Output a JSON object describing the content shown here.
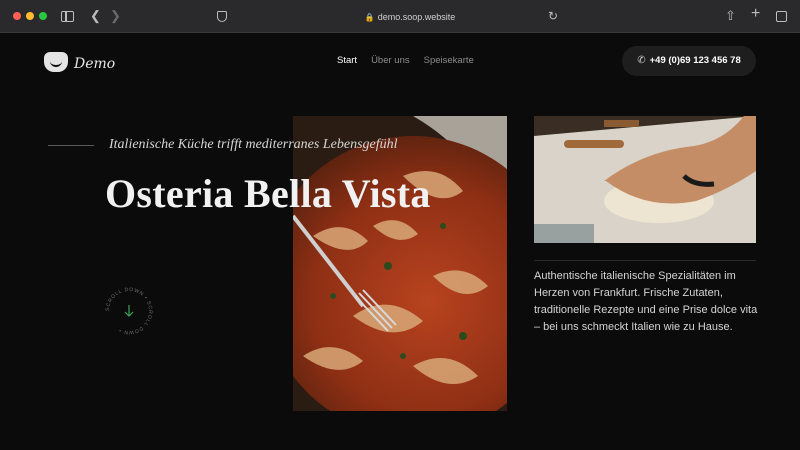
{
  "browser": {
    "url": "demo.soop.website"
  },
  "site": {
    "logo_text": "Demo",
    "nav": [
      {
        "label": "Start"
      },
      {
        "label": "Über uns"
      },
      {
        "label": "Speisekarte"
      }
    ],
    "phone": "+49 (0)69 123 456 78"
  },
  "hero": {
    "tagline": "Italienische Küche trifft mediterranes Lebensgefühl",
    "title": "Osteria Bella Vista",
    "scroll_label": "SCROLL DOWN • SCROLL DOWN •",
    "description": "Authentische italienische Spezialitäten im Herzen von Frankfurt. Frische Zutaten, traditionelle Rezepte und eine Prise dolce vita – bei uns schmeckt Italien wie zu Hause."
  },
  "colors": {
    "background": "#0b0b0b",
    "accent_green": "#3fa35a"
  }
}
